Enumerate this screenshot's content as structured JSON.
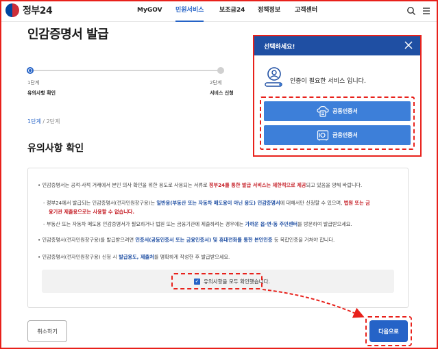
{
  "header": {
    "logo_text": "정부24",
    "nav": [
      {
        "label": "MyGOV"
      },
      {
        "label": "민원서비스",
        "active": true
      },
      {
        "label": "보조금24"
      },
      {
        "label": "정책정보"
      },
      {
        "label": "고객센터"
      }
    ],
    "accent_color": "#2563c7"
  },
  "page": {
    "title": "인감증명서 발급",
    "steps": [
      {
        "step": "1단계",
        "name": "유의사항 확인",
        "current": true
      },
      {
        "step": "2단계",
        "name": "서비스 신청",
        "current": false
      }
    ],
    "crumb_current": "1단계",
    "crumb_rest": " / 2단계",
    "section_title": "유의사항 확인"
  },
  "notice": {
    "l1_a": "인감증명서는 공적·사적 거래에서 본인 의사 확인을 위한 용도로 사용되는 서류로 ",
    "l1_b": "정부24를 통한 발급 서비스는 제한적으로 제공",
    "l1_c": "되고 있음을 양해 바랍니다.",
    "l2_a": "- 정부24에서 발급되는 인감증명서(전자민원창구용)는 ",
    "l2_b": "일반용(부동산 또는 자동차 매도용이 아닌 용도) 인감증명서",
    "l2_c": "에 대해서만 신청할 수 있으며, ",
    "l2_d": "법원 또는 금",
    "l3_a": "융기관 제출용으로는 사용할 수 없습니다.",
    "l4_a": "- 부동산 또는 자동차 매도용 인감증명서가 필요하거나 법원 또는 금융기관에 제출하려는 경우에는 ",
    "l4_b": "가까운 읍·면·동 주민센터",
    "l4_c": "를 방문하여 발급받으세요.",
    "l5_a": "인감증명서(전자민원창구용)를 발급받으려면 ",
    "l5_b": "인증서(공동인증서 또는 금융인증서) 및 휴대전화를 통한 본인인증",
    "l5_c": " 등 복합인증을 거쳐야 합니다.",
    "l6_a": "인감증명서(전자민원창구용) 신청 시 ",
    "l6_b": "발급용도, 제출처",
    "l6_c": "를 명확하게 작성한 후 발급받으세요.",
    "bullet": "•",
    "confirm_label": "유의사항을 모두 확인했습니다.",
    "confirm_checked": "✓"
  },
  "buttons": {
    "cancel": "취소하기",
    "next": "다음으로"
  },
  "modal": {
    "title": "선택하세요!",
    "message": "인증이 필요한 서비스 입니다.",
    "options": [
      {
        "label": "공동인증서",
        "icon": "cloud-certificate-icon"
      },
      {
        "label": "금융인증서",
        "icon": "safe-icon"
      }
    ]
  },
  "annotation_color": "#e8211b"
}
